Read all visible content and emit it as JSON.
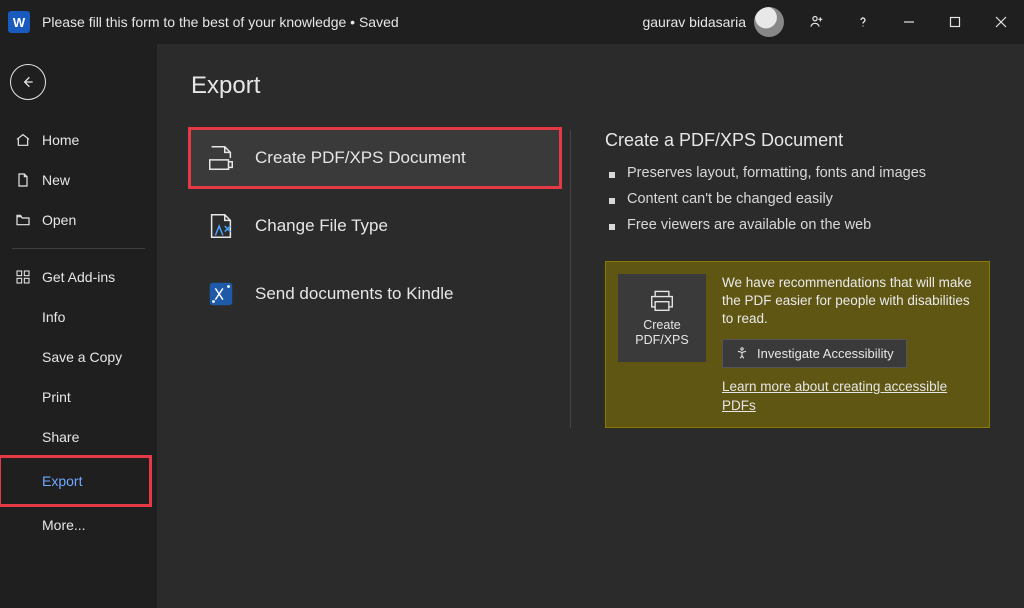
{
  "titlebar": {
    "app_letter": "W",
    "doc_title": "Please fill this form to the best of your knowledge • Saved",
    "user_name": "gaurav bidasaria"
  },
  "nav": {
    "home": "Home",
    "new": "New",
    "open": "Open",
    "get_addins": "Get Add-ins",
    "info": "Info",
    "save_a_copy": "Save a Copy",
    "print": "Print",
    "share": "Share",
    "export": "Export",
    "more": "More..."
  },
  "page": {
    "title": "Export",
    "options": {
      "create_pdf": "Create PDF/XPS Document",
      "change_filetype": "Change File Type",
      "send_kindle": "Send documents to Kindle"
    },
    "detail": {
      "heading": "Create a PDF/XPS Document",
      "bullets": [
        "Preserves layout, formatting, fonts and images",
        "Content can't be changed easily",
        "Free viewers are available on the web"
      ]
    },
    "callout": {
      "big_button_line1": "Create",
      "big_button_line2": "PDF/XPS",
      "body": "We have recommendations that will make the PDF easier for people with disabilities to read.",
      "investigate": "Investigate Accessibility",
      "link": "Learn more about creating accessible PDFs"
    }
  }
}
